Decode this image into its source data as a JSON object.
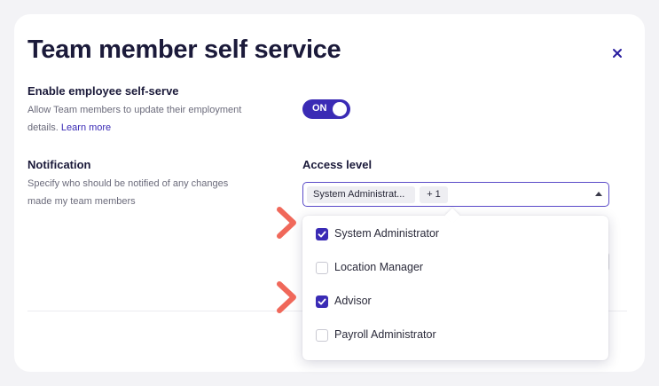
{
  "modal": {
    "title": "Team member self service",
    "close_icon": "close-icon"
  },
  "self_serve": {
    "label": "Enable employee self-serve",
    "description_line1": "Allow Team members to update their employment",
    "description_line2": "details.",
    "link_text": "Learn more",
    "toggle_label": "ON",
    "toggle_on": true
  },
  "notification": {
    "label": "Notification",
    "description_line1": "Specify who should be notified of any changes",
    "description_line2": "made my team members"
  },
  "access_level": {
    "label": "Access level",
    "selected_chip": "System Administrat...",
    "more_chip": "+ 1",
    "caret_icon": "caret-up-icon",
    "options": [
      {
        "label": "System Administrator",
        "checked": true
      },
      {
        "label": "Location Manager",
        "checked": false
      },
      {
        "label": "Advisor",
        "checked": true
      },
      {
        "label": "Payroll Administrator",
        "checked": false
      }
    ]
  },
  "colors": {
    "accent": "#3a2bb5",
    "arrow": "#f0685a",
    "background": "#f3f3f6"
  },
  "annotation_icon": "chevron-right-arrow-icon"
}
